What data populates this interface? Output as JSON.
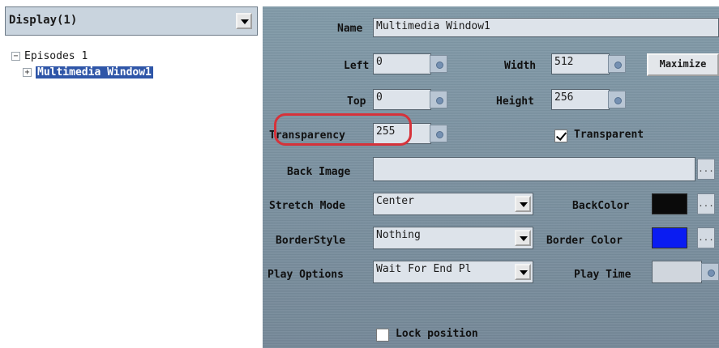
{
  "left": {
    "display_select_value": "Display(1)",
    "tree": {
      "root_label": "Episodes 1",
      "root_toggle": "−",
      "child_label": "Multimedia Window1",
      "child_toggle": "+"
    }
  },
  "props": {
    "name_label": "Name",
    "name_value": "Multimedia Window1",
    "left_label": "Left",
    "left_value": "0",
    "width_label": "Width",
    "width_value": "512",
    "maximize_label": "Maximize",
    "top_label": "Top",
    "top_value": "0",
    "height_label": "Height",
    "height_value": "256",
    "transparency_label": "Transparency",
    "transparency_value": "255",
    "transparent_label": "Transparent",
    "transparent_checked": true,
    "back_image_label": "Back Image",
    "back_image_value": "",
    "stretch_mode_label": "Stretch Mode",
    "stretch_mode_value": "Center",
    "backcolor_label": "BackColor",
    "backcolor": "#0a0a0a",
    "borderstyle_label": "BorderStyle",
    "borderstyle_value": "Nothing",
    "border_color_label": "Border Color",
    "border_color": "#0a1cf2",
    "play_options_label": "Play Options",
    "play_options_value": "Wait For End Pl",
    "play_time_label": "Play Time",
    "play_time_value": "",
    "lock_position_label": "Lock position",
    "lock_position_checked": false,
    "ellipsis": "..."
  },
  "colors": {
    "highlight": "#d6323a",
    "selection": "#2f56a8"
  }
}
